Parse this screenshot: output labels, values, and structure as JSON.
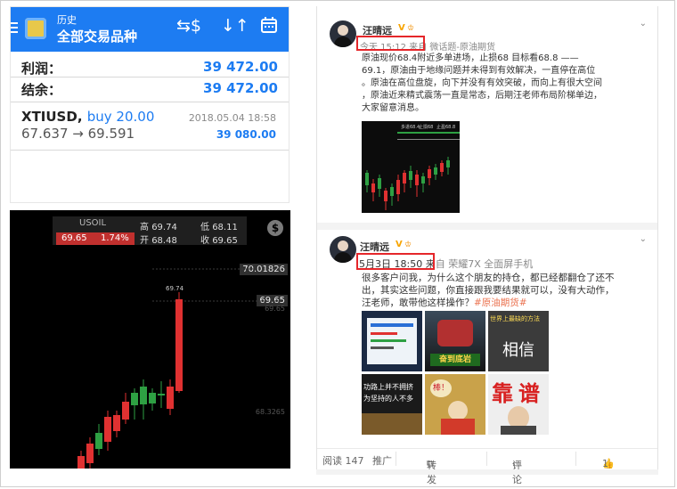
{
  "mt4": {
    "header_sub": "历史",
    "header_title": "全部交易品种",
    "profit_label": "利润：",
    "profit_value": "39 472.00",
    "balance_label": "结余：",
    "balance_value": "39 472.00",
    "position_symbol": "XTIUSD,",
    "position_side": "buy 20.00",
    "position_date": "2018.05.04 18:58",
    "position_prices": "67.637 → 69.591",
    "position_profit": "39 080.00",
    "colors": {
      "header": "#1d7cf2",
      "value": "#1d7cf2"
    }
  },
  "quote": {
    "symbol": "USOIL",
    "price": "69.65",
    "change": "1.74%",
    "high_label": "高",
    "high": "69.74",
    "low_label": "低",
    "low": "68.11",
    "open_label": "开",
    "open": "68.48",
    "close_label": "收",
    "close": "69.65",
    "tag_top": "70.01826",
    "tag_current": "69.65",
    "axis_mid": "69.65",
    "axis_bottom": "68.3265",
    "peak_label": "69.74",
    "coin_icon": "dollar-coin-icon",
    "colors": {
      "up": "#2ea043",
      "down": "#e03131",
      "price_box": "#c0302e"
    }
  },
  "post1": {
    "author": "汪晴远",
    "time": "今天 15:12 来",
    "source": "自 微话题-原油期货",
    "lines": [
      "原油现价68.4附近多单进场，止损68    目标看68.8 ——",
      "69.1，原油由于地缘问题并未得到有效解决，一直停在高位",
      "。原油在高位盘旋，向下并没有有效突破，而向上有很大空间",
      "，原油近来精式震荡一直是常态，后期汪老师布局阶梯单边，",
      "大家留意消息。"
    ],
    "chart_labels": [
      "多进68.4",
      "止损68",
      "止盈68.8"
    ]
  },
  "post2": {
    "author": "汪晴远",
    "time": "5月3日 18:50 来",
    "source": "自 荣耀7X 全面屏手机",
    "lines": [
      "很多客户问我，为什么这个朋友的持仓，都已经都翻仓了还不",
      "出，其实这些问题，你直接跟我要结果就可以，没有大动作，",
      "汪老师，敢带他这样操作？"
    ],
    "hashtag": "#原油期货#",
    "images": [
      {
        "caption": ""
      },
      {
        "caption": "奋到底岩"
      },
      {
        "caption": "相信"
      },
      {
        "caption": "功路上并不拥挤 为坚持的人不多"
      },
      {
        "caption": "棒！"
      },
      {
        "caption": "靠谱"
      }
    ],
    "img3_top": "世界上最缺的方法"
  },
  "footer": {
    "read": "阅读 147",
    "promote": "推广",
    "repost": "转发",
    "comment": "评论",
    "like": "1",
    "repost_icon": "share-icon",
    "comment_icon": "comment-icon",
    "like_icon": "thumbs-up-icon"
  }
}
